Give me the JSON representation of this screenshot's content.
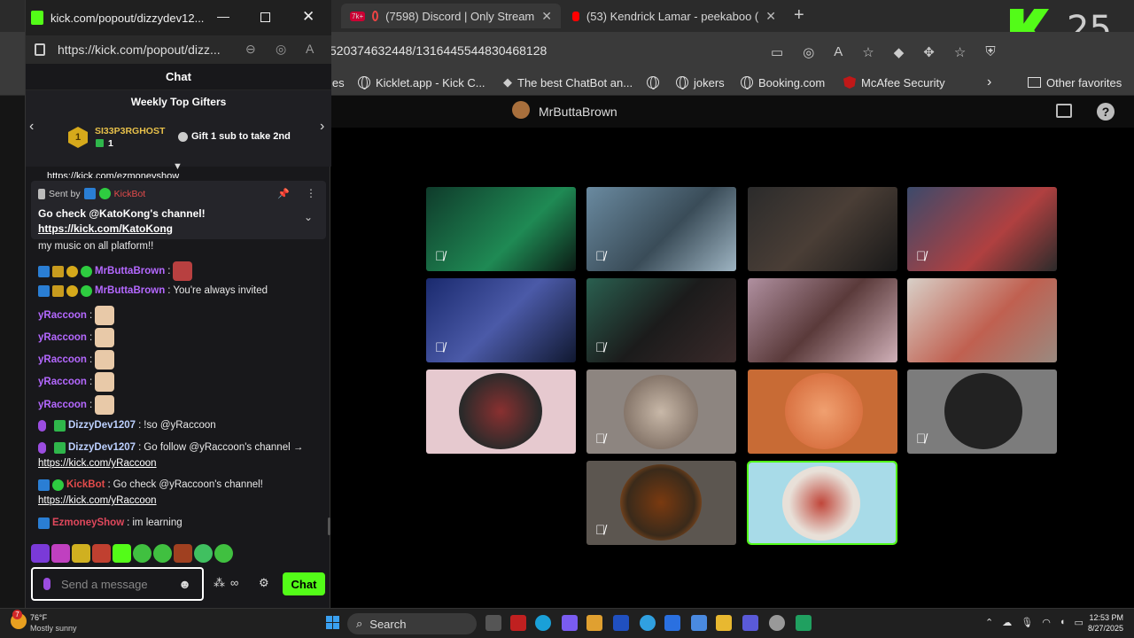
{
  "browser": {
    "tabs": [
      {
        "badge": "7k+",
        "label": "(7598) Discord | Only Stream"
      },
      {
        "label": "(53) Kendrick Lamar - peekaboo ("
      }
    ],
    "url": "520374632448/1316445544830468128",
    "favorites": [
      "les",
      "Kicklet.app - Kick C...",
      "The best ChatBot an...",
      "jokers",
      "Booking.com",
      "McAfee Security"
    ],
    "other_favorites": "Other favorites",
    "streamer": "MrButtaBrown",
    "logo_number": "25"
  },
  "popout": {
    "title": "kick.com/popout/dizzydev12...",
    "url": "https://kick.com/popout/dizz...",
    "chat_title": "Chat",
    "gifters_title": "Weekly Top Gifters",
    "gifter_name": "SI33P3RGHOST",
    "gifter_rank": "1",
    "gifter_count": "1",
    "gift_cta": "Gift 1 sub to take 2nd",
    "cut_link": "https://kick.com/ezmoneyshow"
  },
  "pinned": {
    "sent_by": "Sent by",
    "author": "KickBot",
    "text": "Go check @KatoKong's channel!",
    "link": "https://kick.com/KatoKong"
  },
  "messages": {
    "m0": "my music on all platform!!",
    "m1_user": "MrButtaBrown",
    "m2_user": "MrButtaBrown",
    "m2_text": "You're always invited",
    "raccoon": "yRaccoon",
    "m8_user": "DizzyDev1207",
    "m8_text": "!so @yRaccoon",
    "m9_user": "DizzyDev1207",
    "m9_text": "Go follow @yRaccoon's channel →",
    "m9_link": "https://kick.com/yRaccoon",
    "m10_user": "KickBot",
    "m10_text": "Go check @yRaccoon's channel!",
    "m10_link": "https://kick.com/yRaccoon",
    "m11_user": "EzmoneyShow",
    "m11_text": "im learning",
    "colon": ":"
  },
  "input": {
    "placeholder": "Send a message",
    "send_label": "Chat"
  },
  "taskbar": {
    "weather_temp": "76°F",
    "weather_desc": "Mostly sunny",
    "search": "Search",
    "time": "12:53 PM",
    "date": "8/27/2025",
    "notif": "7"
  },
  "colors": {
    "kick_green": "#53fc18",
    "panel": "#18181b"
  }
}
